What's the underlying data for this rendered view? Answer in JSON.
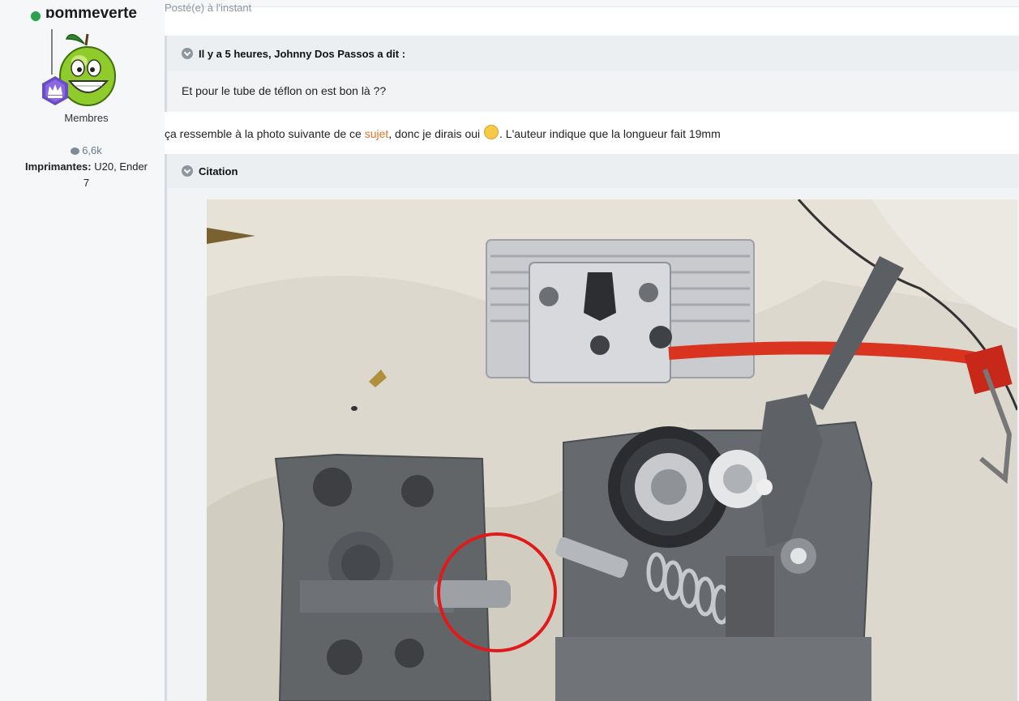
{
  "author": {
    "name": "pommeverte",
    "role": "Membres",
    "post_count": "6,6k",
    "printers_label": "Imprimantes:",
    "printers_value": "U20, Ender 7"
  },
  "post": {
    "posted": "Posté(e) à l'instant",
    "quote1": {
      "header": "Il y a 5 heures, Johnny Dos Passos a dit :",
      "body": "Et pour le tube de téflon on est bon là ??"
    },
    "paragraph": {
      "before": "ça ressemble à la photo suivante de ce ",
      "link": "sujet",
      "middle": ", donc je dirais oui ",
      "after": ". L'auteur indique que la longueur fait 19mm"
    },
    "quote2": {
      "header": "Citation"
    }
  },
  "icons": {
    "online": "online-dot",
    "badge": "crown-rank-badge",
    "stat": "comment-bubble-icon",
    "emoji": "grinning-sweat-emoji",
    "expand": "chevron-down-icon"
  },
  "colors": {
    "link": "#e0742a",
    "online": "#2aa14e",
    "sidebar": "#f5f7f8"
  }
}
